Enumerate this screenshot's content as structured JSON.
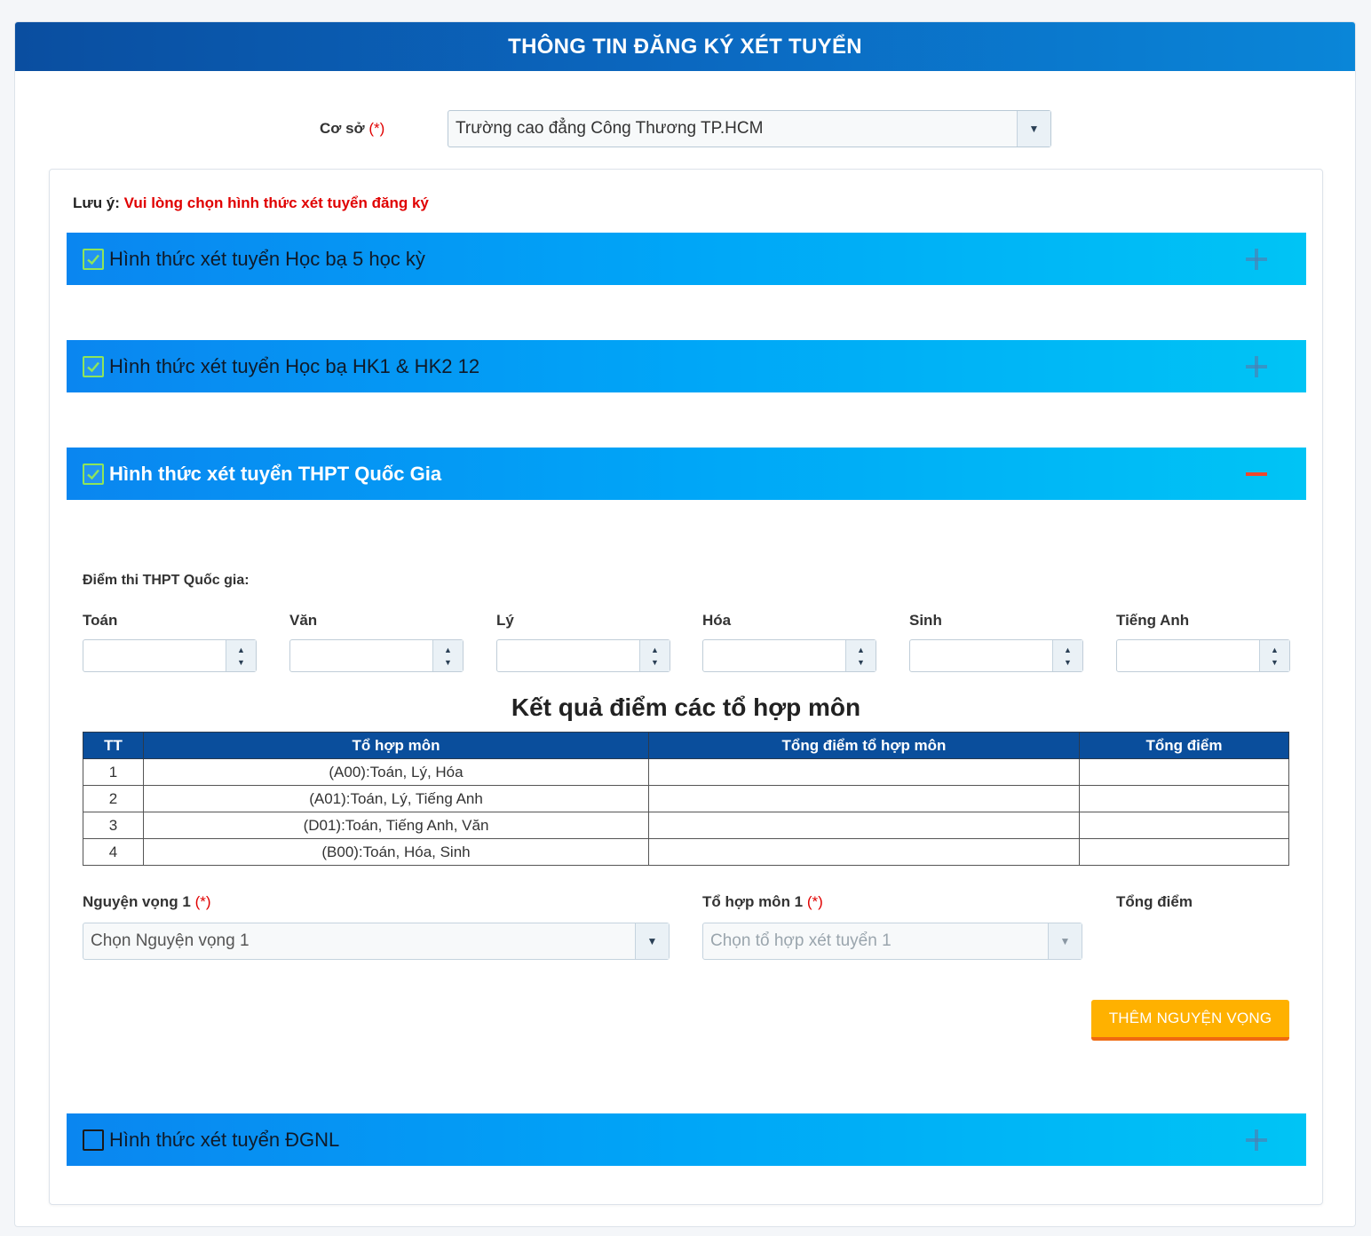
{
  "header": {
    "title": "THÔNG TIN ĐĂNG KÝ XÉT TUYỂN"
  },
  "coso": {
    "label": "Cơ sở",
    "required_mark": "(*)",
    "value": "Trường cao đẳng Công Thương TP.HCM",
    "arrow": "▼"
  },
  "note": {
    "prefix": "Lưu ý:",
    "text": "Vui lòng chọn hình thức xét tuyển đăng ký"
  },
  "sections": [
    {
      "title": "Hình thức xét tuyển Học bạ 5 học kỳ",
      "checked": true,
      "expanded": false
    },
    {
      "title": "Hình thức xét tuyển Học bạ HK1 & HK2 12",
      "checked": true,
      "expanded": false
    },
    {
      "title": "Hình thức xét tuyển THPT Quốc Gia",
      "checked": true,
      "expanded": true
    },
    {
      "title": "Hình thức xét tuyển ĐGNL",
      "checked": false,
      "expanded": false
    }
  ],
  "thpt": {
    "scores_title": "Điểm thi THPT Quốc gia:",
    "subjects": [
      "Toán",
      "Văn",
      "Lý",
      "Hóa",
      "Sinh",
      "Tiếng Anh"
    ],
    "spin_up": "▲",
    "spin_down": "▼",
    "results_title": "Kết quả điểm các tổ hợp môn",
    "table": {
      "headers": [
        "TT",
        "Tổ hợp môn",
        "Tổng điểm tổ hợp môn",
        "Tổng điểm"
      ],
      "rows": [
        [
          "1",
          "(A00):Toán, Lý, Hóa",
          "",
          ""
        ],
        [
          "2",
          "(A01):Toán, Lý, Tiếng Anh",
          "",
          ""
        ],
        [
          "3",
          "(D01):Toán, Tiếng Anh, Văn",
          "",
          ""
        ],
        [
          "4",
          "(B00):Toán, Hóa, Sinh",
          "",
          ""
        ]
      ]
    },
    "nguyen_vong_label": "Nguyện vọng 1",
    "nguyen_vong_placeholder": "Chọn Nguyện vọng 1",
    "to_hop_label": "Tổ hợp môn 1",
    "to_hop_placeholder": "Chọn tổ hợp xét tuyển 1",
    "tong_diem_label": "Tổng điểm",
    "required_mark": "(*)",
    "add_button": "THÊM NGUYỆN VỌNG"
  },
  "colors": {
    "header_blue": "#0a4e9c",
    "accordion_blue": "#00a6f7",
    "required_red": "#e00000",
    "button_orange": "#ffb100",
    "minus_red": "#f0472a",
    "check_green": "#8ee55a"
  }
}
